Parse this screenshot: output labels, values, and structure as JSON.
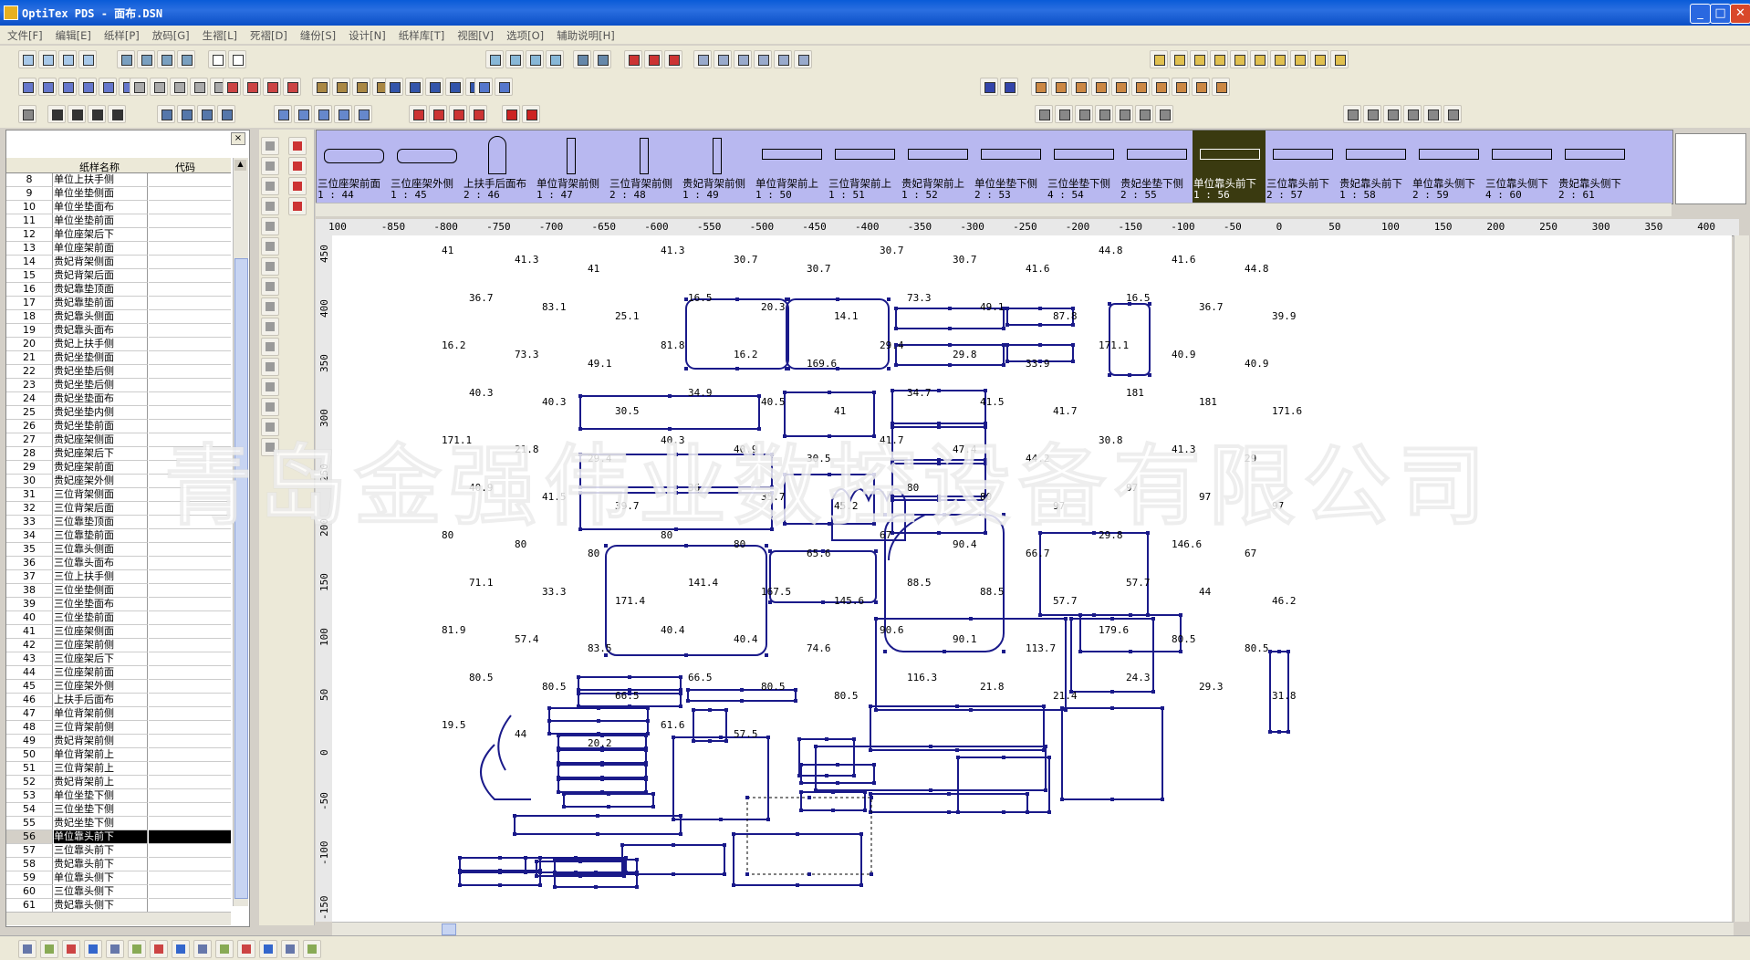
{
  "window": {
    "title": "OptiTex PDS - 面布.DSN"
  },
  "menu": [
    "文件[F]",
    "编辑[E]",
    "纸样[P]",
    "放码[G]",
    "生褶[L]",
    "死褶[D]",
    "缝份[S]",
    "设计[N]",
    "纸样库[T]",
    "视图[V]",
    "选项[O]",
    "辅助说明[H]"
  ],
  "panel": {
    "col_name": "纸样名称",
    "col_code": "代码",
    "rows": [
      {
        "n": "8",
        "name": "单位上扶手侧"
      },
      {
        "n": "9",
        "name": "单位坐垫侧面"
      },
      {
        "n": "10",
        "name": "单位坐垫面布"
      },
      {
        "n": "11",
        "name": "单位坐垫前面"
      },
      {
        "n": "12",
        "name": "单位座架后下"
      },
      {
        "n": "13",
        "name": "单位座架前面"
      },
      {
        "n": "14",
        "name": "贵妃背架侧面"
      },
      {
        "n": "15",
        "name": "贵妃背架后面"
      },
      {
        "n": "16",
        "name": "贵妃靠垫顶面"
      },
      {
        "n": "17",
        "name": "贵妃靠垫前面"
      },
      {
        "n": "18",
        "name": "贵妃靠头侧面"
      },
      {
        "n": "19",
        "name": "贵妃靠头面布"
      },
      {
        "n": "20",
        "name": "贵妃上扶手侧"
      },
      {
        "n": "21",
        "name": "贵妃坐垫侧面"
      },
      {
        "n": "22",
        "name": "贵妃坐垫后侧"
      },
      {
        "n": "23",
        "name": "贵妃坐垫后侧"
      },
      {
        "n": "24",
        "name": "贵妃坐垫面布"
      },
      {
        "n": "25",
        "name": "贵妃坐垫内侧"
      },
      {
        "n": "26",
        "name": "贵妃坐垫前面"
      },
      {
        "n": "27",
        "name": "贵妃座架侧面"
      },
      {
        "n": "28",
        "name": "贵妃座架后下"
      },
      {
        "n": "29",
        "name": "贵妃座架前面"
      },
      {
        "n": "30",
        "name": "贵妃座架外侧"
      },
      {
        "n": "31",
        "name": "三位背架侧面"
      },
      {
        "n": "32",
        "name": "三位背架后面"
      },
      {
        "n": "33",
        "name": "三位靠垫顶面"
      },
      {
        "n": "34",
        "name": "三位靠垫前面"
      },
      {
        "n": "35",
        "name": "三位靠头侧面"
      },
      {
        "n": "36",
        "name": "三位靠头面布"
      },
      {
        "n": "37",
        "name": "三位上扶手侧"
      },
      {
        "n": "38",
        "name": "三位坐垫侧面"
      },
      {
        "n": "39",
        "name": "三位坐垫面布"
      },
      {
        "n": "40",
        "name": "三位坐垫前面"
      },
      {
        "n": "41",
        "name": "三位座架侧面"
      },
      {
        "n": "42",
        "name": "三位座架前侧"
      },
      {
        "n": "43",
        "name": "三位座架后下"
      },
      {
        "n": "44",
        "name": "三位座架前面"
      },
      {
        "n": "45",
        "name": "三位座架外侧"
      },
      {
        "n": "46",
        "name": "上扶手后面布"
      },
      {
        "n": "47",
        "name": "单位背架前侧"
      },
      {
        "n": "48",
        "name": "三位背架前侧"
      },
      {
        "n": "49",
        "name": "贵妃背架前侧"
      },
      {
        "n": "50",
        "name": "单位背架前上"
      },
      {
        "n": "51",
        "name": "三位背架前上"
      },
      {
        "n": "52",
        "name": "贵妃背架前上"
      },
      {
        "n": "53",
        "name": "单位坐垫下侧"
      },
      {
        "n": "54",
        "name": "三位坐垫下侧"
      },
      {
        "n": "55",
        "name": "贵妃坐垫下侧"
      },
      {
        "n": "56",
        "name": "单位靠头前下",
        "selected": true
      },
      {
        "n": "57",
        "name": "三位靠头前下"
      },
      {
        "n": "58",
        "name": "贵妃靠头前下"
      },
      {
        "n": "59",
        "name": "单位靠头侧下"
      },
      {
        "n": "60",
        "name": "三位靠头侧下"
      },
      {
        "n": "61",
        "name": "贵妃靠头侧下"
      }
    ]
  },
  "thumbs": [
    {
      "name": "三位座架前面",
      "num": "1 : 44"
    },
    {
      "name": "三位座架外侧",
      "num": "1 : 45"
    },
    {
      "name": "上扶手后面布",
      "num": "2 : 46"
    },
    {
      "name": "单位背架前侧",
      "num": "1 : 47"
    },
    {
      "name": "三位背架前侧",
      "num": "2 : 48"
    },
    {
      "name": "贵妃背架前侧",
      "num": "1 : 49"
    },
    {
      "name": "单位背架前上",
      "num": "1 : 50"
    },
    {
      "name": "三位背架前上",
      "num": "1 : 51"
    },
    {
      "name": "贵妃背架前上",
      "num": "1 : 52"
    },
    {
      "name": "单位坐垫下侧",
      "num": "2 : 53"
    },
    {
      "name": "三位坐垫下侧",
      "num": "4 : 54"
    },
    {
      "name": "贵妃坐垫下侧",
      "num": "2 : 55"
    },
    {
      "name": "单位靠头前下",
      "num": "1 : 56",
      "active": true
    },
    {
      "name": "三位靠头前下",
      "num": "2 : 57"
    },
    {
      "name": "贵妃靠头前下",
      "num": "1 : 58"
    },
    {
      "name": "单位靠头侧下",
      "num": "2 : 59"
    },
    {
      "name": "三位靠头侧下",
      "num": "4 : 60"
    },
    {
      "name": "贵妃靠头侧下",
      "num": "2 : 61"
    }
  ],
  "ruler_h": [
    "100",
    "-850",
    "-800",
    "-750",
    "-700",
    "-650",
    "-600",
    "-550",
    "-500",
    "-450",
    "-400",
    "-350",
    "-300",
    "-250",
    "-200",
    "-150",
    "-100",
    "-50",
    "0",
    "50",
    "100",
    "150",
    "200",
    "250",
    "300",
    "350",
    "400"
  ],
  "ruler_v": [
    "450",
    "400",
    "350",
    "300",
    "250",
    "200",
    "150",
    "100",
    "50",
    "0",
    "-50",
    "-100",
    "-150"
  ],
  "watermark": "青岛金强伟业数控设备有限公司",
  "dims": [
    "41",
    "41.3",
    "41",
    "41.3",
    "30.7",
    "30.7",
    "30.7",
    "30.7",
    "41.6",
    "44.8",
    "41.6",
    "44.8",
    "36.7",
    "83.1",
    "25.1",
    "16.5",
    "20.3",
    "14.1",
    "73.3",
    "49.1",
    "87.8",
    "16.5",
    "36.7",
    "39.9",
    "16.2",
    "73.3",
    "49.1",
    "81.8",
    "16.2",
    "169.6",
    "29.4",
    "29.8",
    "33.9",
    "171.1",
    "40.9",
    "40.9",
    "40.3",
    "40.3",
    "30.5",
    "34.9",
    "40.5",
    "41",
    "34.7",
    "41.5",
    "41.7",
    "181",
    "181",
    "171.6",
    "171.1",
    "21.8",
    "29.4",
    "40.3",
    "40.9",
    "30.5",
    "41.7",
    "47.4",
    "44.2",
    "30.8",
    "41.3",
    "29",
    "40.9",
    "41.5",
    "39.7",
    "36",
    "35.7",
    "45.2",
    "80",
    "80",
    "97",
    "97",
    "97",
    "97",
    "80",
    "80",
    "80",
    "80",
    "80",
    "65.6",
    "67",
    "90.4",
    "66.7",
    "29.8",
    "146.6",
    "67",
    "71.1",
    "33.3",
    "171.4",
    "141.4",
    "167.5",
    "145.6",
    "88.5",
    "88.5",
    "57.7",
    "57.7",
    "44",
    "46.2",
    "81.9",
    "57.4",
    "83.5",
    "40.4",
    "40.4",
    "74.6",
    "90.6",
    "90.1",
    "113.7",
    "179.6",
    "80.5",
    "80.5",
    "80.5",
    "80.5",
    "66.5",
    "66.5",
    "80.5",
    "80.5",
    "116.3",
    "21.8",
    "21.4",
    "24.3",
    "29.3",
    "31.8",
    "19.5",
    "44",
    "20.2",
    "61.6",
    "57.5"
  ]
}
